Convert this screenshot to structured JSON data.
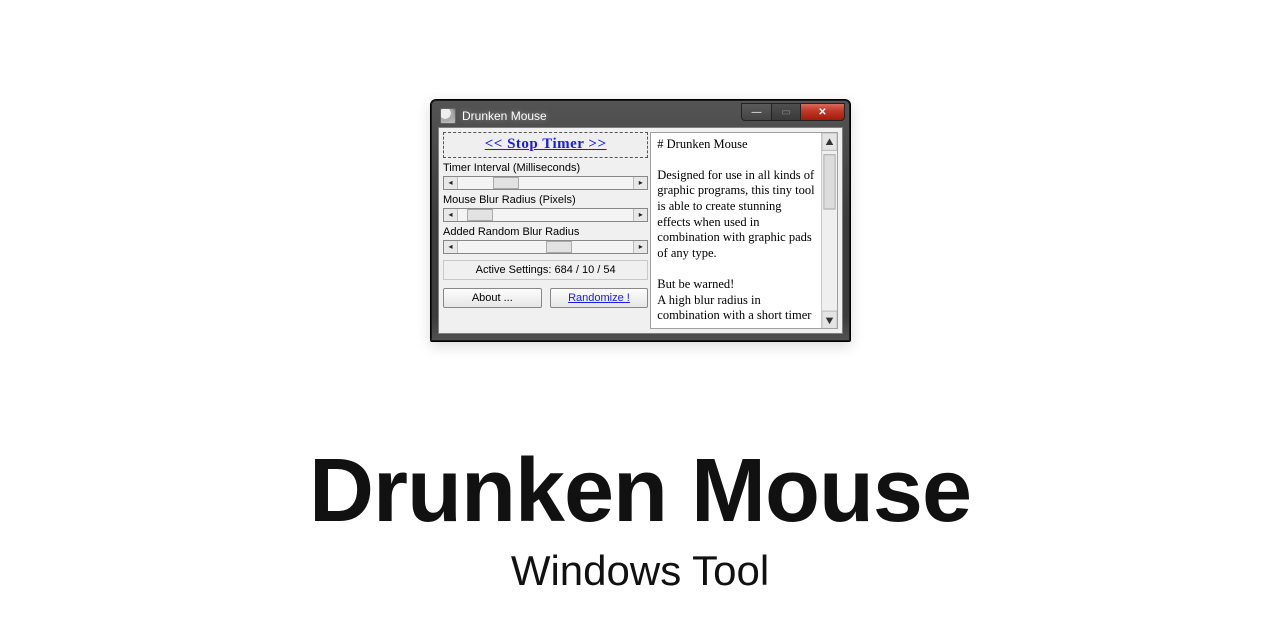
{
  "headline": {
    "title": "Drunken Mouse",
    "subtitle": "Windows Tool"
  },
  "window": {
    "title": "Drunken Mouse",
    "buttons": {
      "minimize_glyph": "—",
      "maximize_glyph": "▭",
      "close_glyph": "✕"
    }
  },
  "controls": {
    "stop_timer_label": "<<  Stop Timer  >>",
    "sliders": [
      {
        "label": "Timer Interval (Milliseconds)",
        "thumb_left_pct": 20
      },
      {
        "label": "Mouse Blur Radius (Pixels)",
        "thumb_left_pct": 5
      },
      {
        "label": "Added Random Blur Radius",
        "thumb_left_pct": 50
      }
    ],
    "active_settings_label": "Active Settings: 684 / 10 / 54",
    "active_settings": {
      "timer_interval_ms": 684,
      "blur_radius_px": 10,
      "random_blur_radius": 54
    },
    "about_label": "About ...",
    "randomize_label": "Randomize !"
  },
  "description": {
    "heading": "# Drunken Mouse",
    "body": "Designed for use in all kinds of graphic programs, this tiny tool is able to create stunning effects when used in combination with graphic pads of any type.\n\nBut be warned!\nA high blur radius in combination with a short timer"
  }
}
